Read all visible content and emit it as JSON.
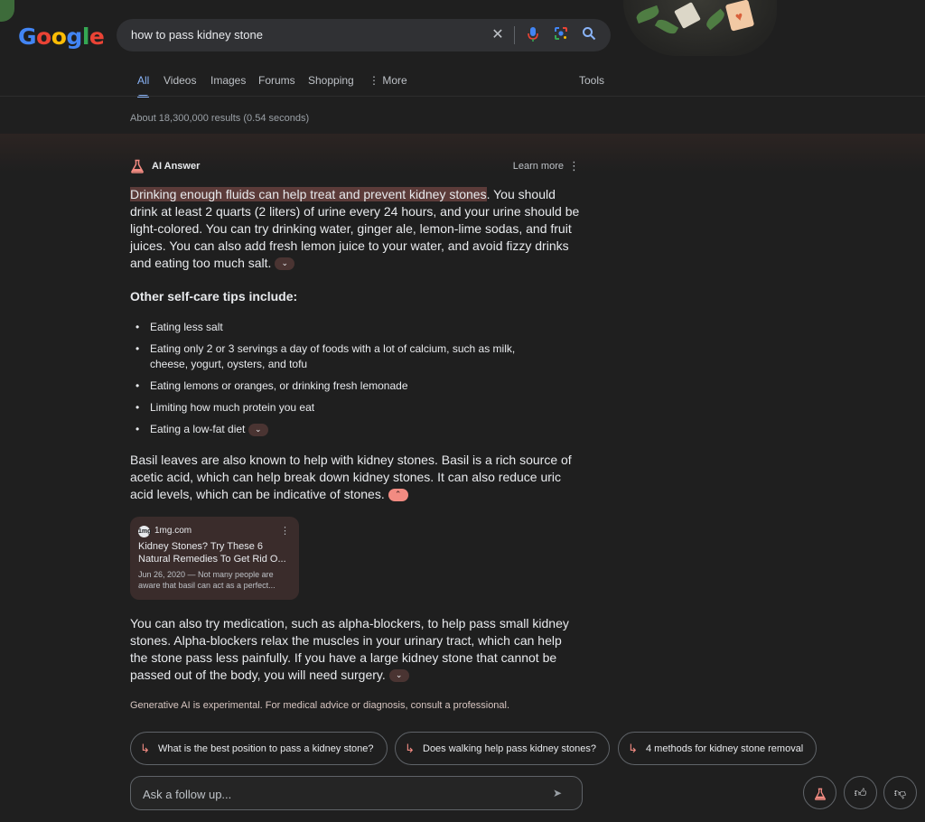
{
  "header": {
    "logo_letters": [
      "G",
      "o",
      "o",
      "g",
      "l",
      "e"
    ],
    "search_query": "how to pass kidney stone",
    "icons": [
      "clear-icon",
      "mic-icon",
      "lens-icon",
      "search-icon"
    ]
  },
  "tabs": [
    {
      "label": "All",
      "active": true
    },
    {
      "label": "Videos"
    },
    {
      "label": "Images"
    },
    {
      "label": "Forums"
    },
    {
      "label": "Shopping"
    },
    {
      "label": "More"
    },
    {
      "label": "Tools"
    }
  ],
  "result_stats": "About 18,300,000 results (0.54 seconds)",
  "ai": {
    "label": "AI Answer",
    "learn_more": "Learn more",
    "para1_highlight": "Drinking enough fluids can help treat and prevent kidney stones",
    "para1_rest": ". You should drink at least 2 quarts (2 liters) of urine every 24 hours, and your urine should be light-colored. You can try drinking water, ginger ale, lemon-lime sodas, and fruit juices. You can also add fresh lemon juice to your water, and avoid fizzy drinks and eating too much salt.",
    "subheading": "Other self-care tips include:",
    "tips": [
      "Eating less salt",
      "Eating only 2 or 3 servings a day of foods with a lot of calcium, such as milk, cheese, yogurt, oysters, and tofu",
      "Eating lemons or oranges, or drinking fresh lemonade",
      "Limiting how much protein you eat",
      "Eating a low-fat diet"
    ],
    "para2": "Basil leaves are also known to help with kidney stones. Basil is a rich source of acetic acid, which can help break down kidney stones. It can also reduce uric acid levels, which can be indicative of stones.",
    "source": {
      "site": "1mg.com",
      "favicon_text": "1mg",
      "title": "Kidney Stones? Try These 6 Natural Remedies To Get Rid O...",
      "snippet": "Jun 26, 2020 — Not many people are aware that basil can act as a perfect..."
    },
    "para3": "You can also try medication, such as alpha-blockers, to help pass small kidney stones. Alpha-blockers relax the muscles in your urinary tract, which can help the stone pass less painfully. If you have a large kidney stone that cannot be passed out of the body, you will need surgery.",
    "disclaimer": "Generative AI is experimental. For medical advice or diagnosis, consult a professional."
  },
  "suggestions": [
    "What is the best position to pass a kidney stone?",
    "Does walking help pass kidney stones?",
    "4 methods for kidney stone removal"
  ],
  "followup_placeholder": "Ask a follow up...",
  "colors": {
    "background": "#1f1f1f",
    "link_blue": "#8ab4f8",
    "ai_accent": "#f28b82",
    "highlight": "#5c3b39"
  }
}
